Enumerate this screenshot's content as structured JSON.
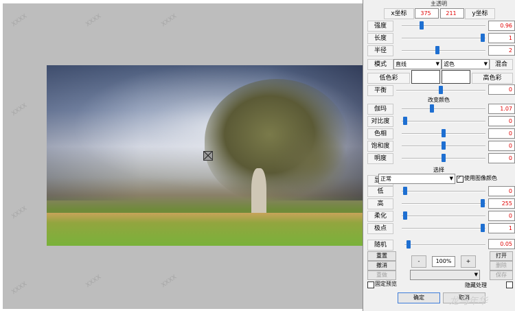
{
  "panel": {
    "title": "主透明",
    "coord": {
      "x_label": "x坐标",
      "x_value": "375",
      "y_value": "211",
      "y_label": "y坐标"
    },
    "rows": [
      {
        "label": "强度",
        "value": "0.96",
        "pct": 0.22
      },
      {
        "label": "长度",
        "value": "1",
        "pct": 0.99
      },
      {
        "label": "半径",
        "value": "2",
        "pct": 0.42
      }
    ],
    "mode": {
      "label": "模式",
      "select1": "直线",
      "select2": "滤色",
      "mix_label": "混合"
    },
    "colors": {
      "low_label": "低色彩",
      "high_label": "高色彩"
    },
    "balance": {
      "label": "平衡",
      "value": "0",
      "pct": 0.5
    },
    "change_color_title": "改变颜色",
    "color_rows": [
      {
        "label": "伽玛",
        "value": "1.07",
        "pct": 0.35
      },
      {
        "label": "对比度",
        "value": "0",
        "pct": 0.02
      },
      {
        "label": "色相",
        "value": "0",
        "pct": 0.5
      },
      {
        "label": "饱和度",
        "value": "0",
        "pct": 0.5
      },
      {
        "label": "明度",
        "value": "0",
        "pct": 0.5
      }
    ],
    "select_title": "选择",
    "display": {
      "label": "显示",
      "value": "正常",
      "use_image_color": "使用图像颜色"
    },
    "select_rows": [
      {
        "label": "低",
        "value": "0",
        "pct": 0.02
      },
      {
        "label": "高",
        "value": "255",
        "pct": 0.99
      },
      {
        "label": "柔化",
        "value": "0",
        "pct": 0.02
      },
      {
        "label": "极点",
        "value": "1",
        "pct": 0.99
      }
    ],
    "random": {
      "label": "随机",
      "value": "0.05",
      "pct": 0.03
    },
    "buttons": {
      "reset": "重置",
      "cancel": "撤消",
      "redo": "重做",
      "open": "打开",
      "delete": "删除",
      "save": "保存",
      "minus": "-",
      "zoom": "100%",
      "plus": "+"
    },
    "fixed_preview": "固定预览",
    "hide_process": "隐藏处理",
    "ok": "确定",
    "cancel_bottom": "取消"
  },
  "watermark": "龙马年华",
  "photo_watermark": "XXXX"
}
